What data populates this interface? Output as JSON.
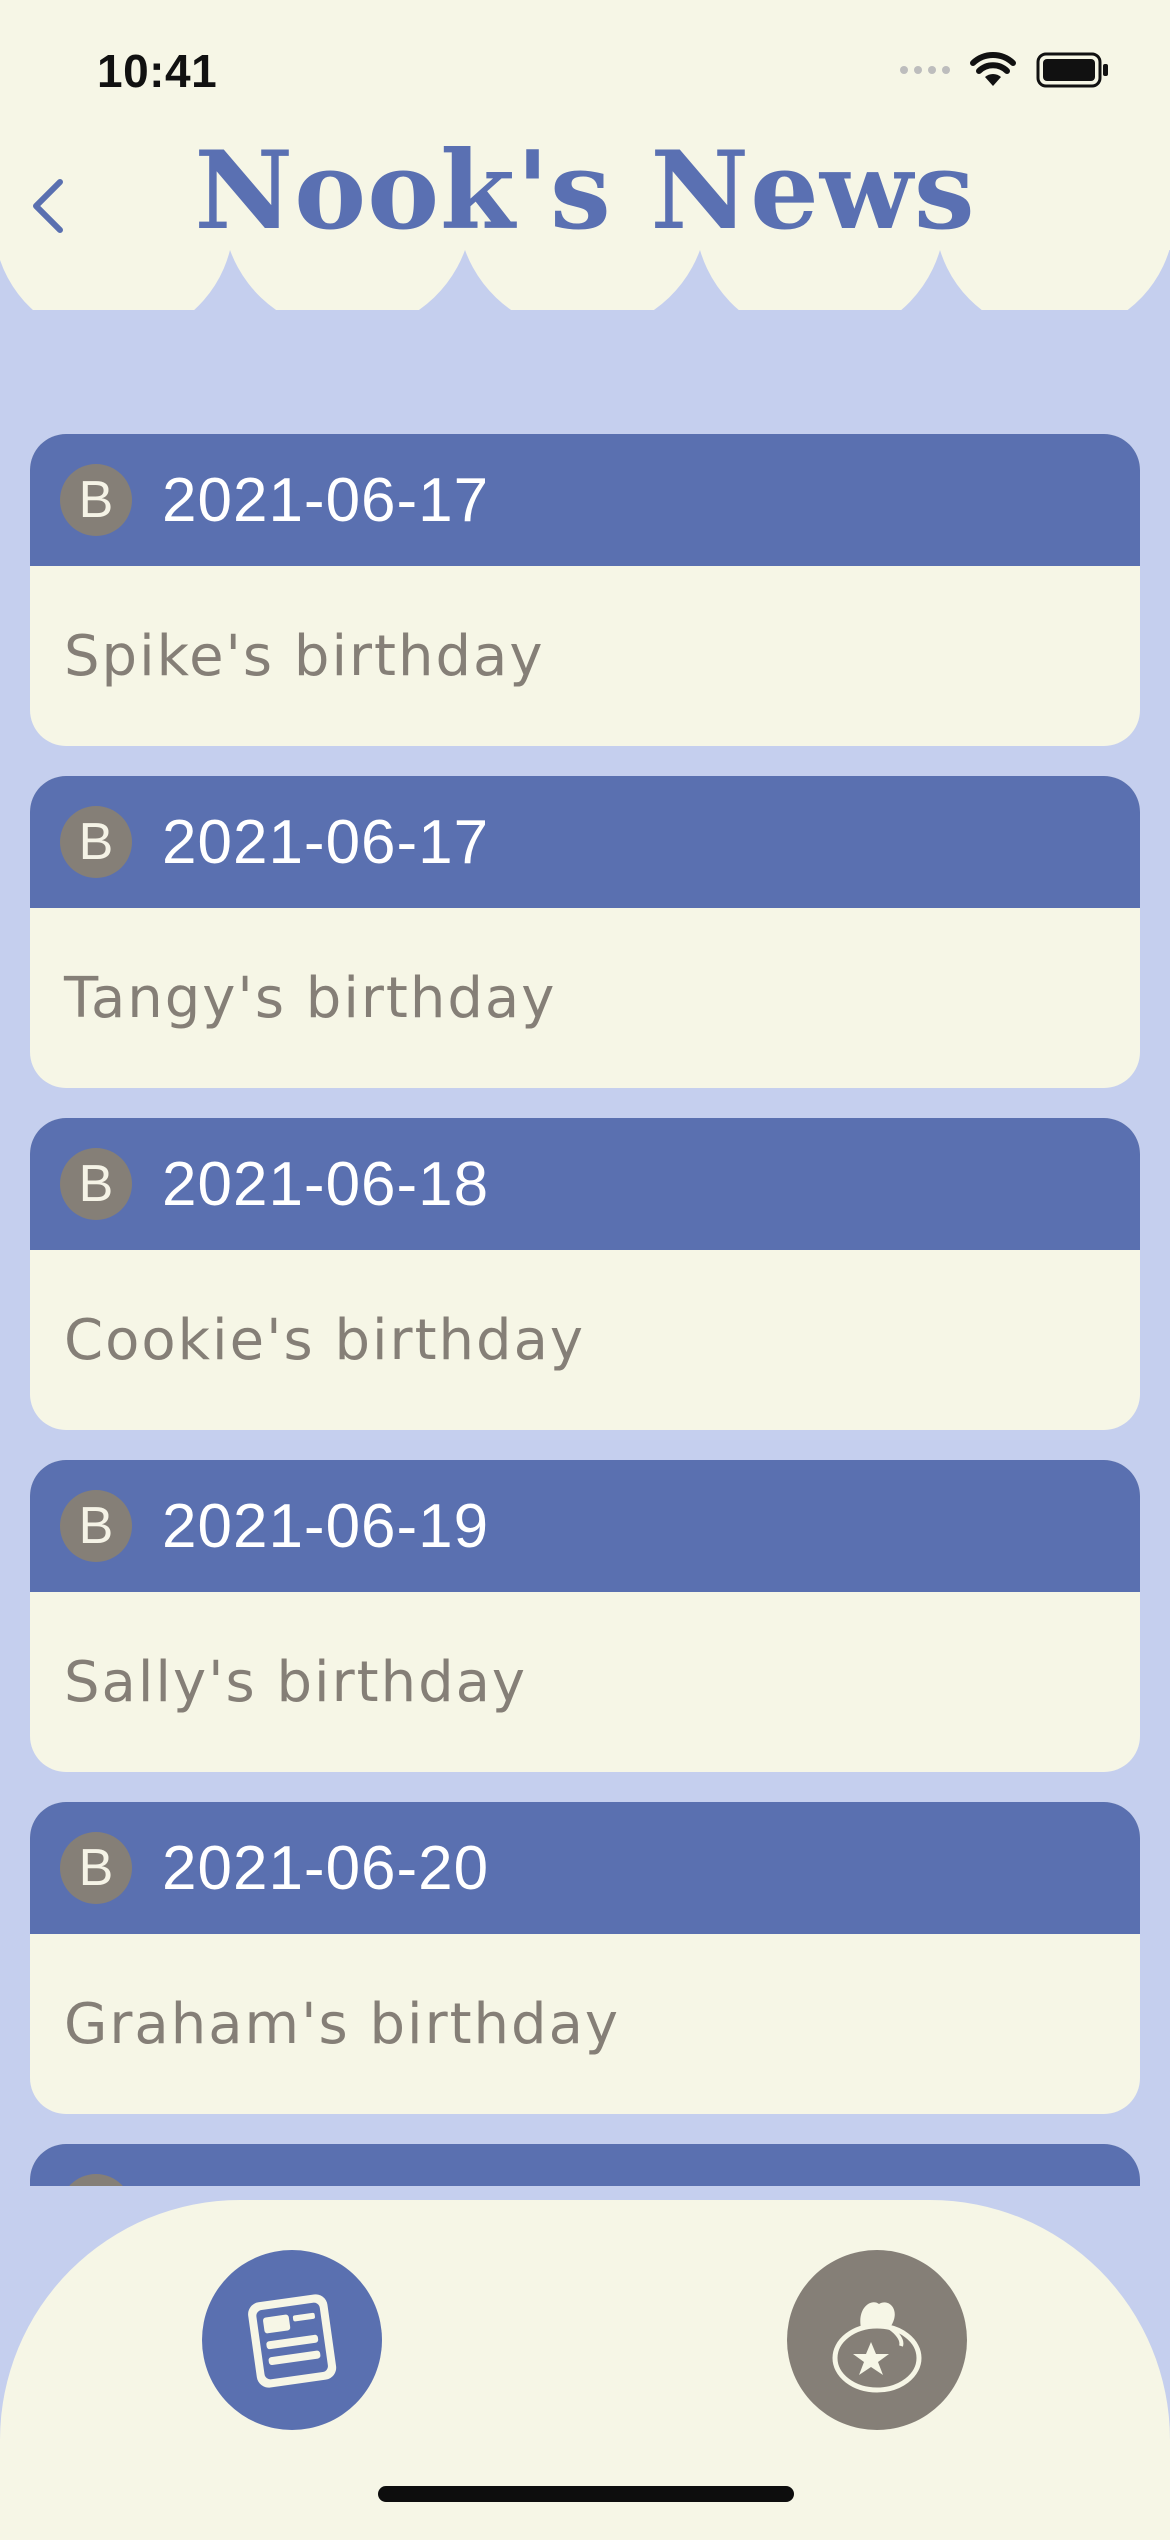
{
  "status_bar": {
    "time": "10:41"
  },
  "header": {
    "title": "Nook's News"
  },
  "news": [
    {
      "badge": "B",
      "date": "2021-06-17",
      "text": "Spike's birthday"
    },
    {
      "badge": "B",
      "date": "2021-06-17",
      "text": "Tangy's birthday"
    },
    {
      "badge": "B",
      "date": "2021-06-18",
      "text": "Cookie's birthday"
    },
    {
      "badge": "B",
      "date": "2021-06-19",
      "text": "Sally's birthday"
    },
    {
      "badge": "B",
      "date": "2021-06-20",
      "text": "Graham's birthday"
    },
    {
      "badge": "B",
      "date": "",
      "text": ""
    }
  ],
  "tabbar": {
    "icons": [
      "newspaper-icon",
      "bag-icon"
    ]
  },
  "colors": {
    "accent": "#5a70b0",
    "background": "#c5cfee",
    "cream": "#f6f6e6",
    "taupe": "#857f77"
  }
}
